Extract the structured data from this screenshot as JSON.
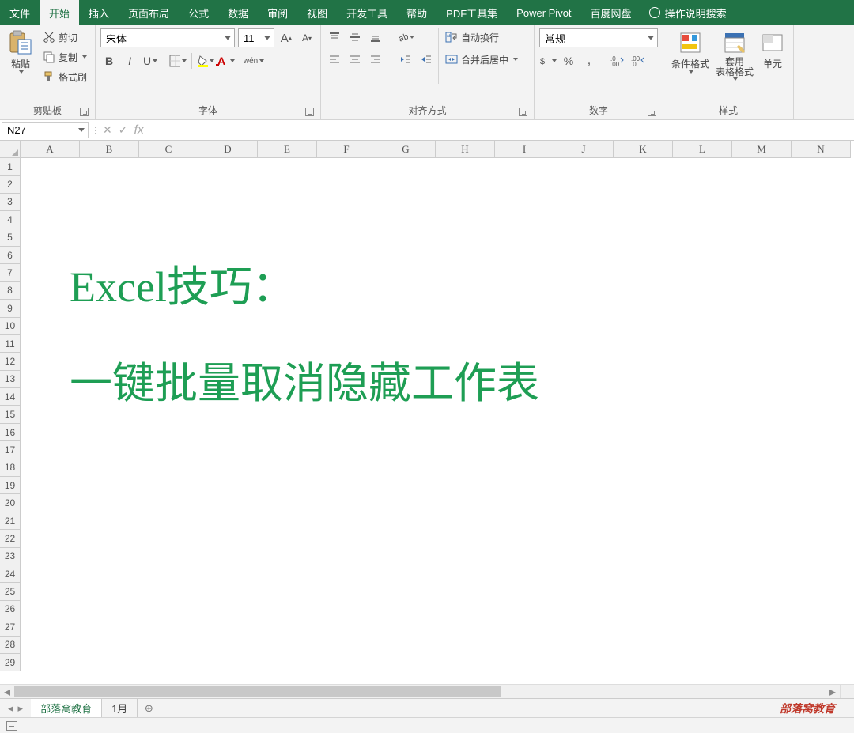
{
  "tabs": {
    "file": "文件",
    "home": "开始",
    "insert": "插入",
    "layout": "页面布局",
    "formulas": "公式",
    "data": "数据",
    "review": "审阅",
    "view": "视图",
    "dev": "开发工具",
    "help": "帮助",
    "pdf": "PDF工具集",
    "pivot": "Power Pivot",
    "baidu": "百度网盘",
    "tell": "操作说明搜索"
  },
  "ribbon": {
    "clipboard": {
      "label": "剪贴板",
      "paste": "粘贴",
      "cut": "剪切",
      "copy": "复制",
      "painter": "格式刷"
    },
    "font": {
      "label": "字体",
      "name": "宋体",
      "size": "11",
      "bold": "B",
      "italic": "I",
      "underline": "U",
      "phonetic": "wén"
    },
    "align": {
      "label": "对齐方式",
      "wrap": "自动换行",
      "merge": "合并后居中"
    },
    "number": {
      "label": "数字",
      "format": "常规"
    },
    "styles": {
      "label": "样式",
      "cond": "条件格式",
      "table": "套用\n表格格式",
      "cell": "单元"
    }
  },
  "namebox": "N27",
  "fx_label": "fx",
  "columns": [
    "A",
    "B",
    "C",
    "D",
    "E",
    "F",
    "G",
    "H",
    "I",
    "J",
    "K",
    "L",
    "M",
    "N"
  ],
  "rows_count": 29,
  "content": {
    "line1": "Excel技巧：",
    "line2": "一键批量取消隐藏工作表"
  },
  "sheets": {
    "active": "部落窝教育",
    "other": "1月",
    "add": "⊕"
  },
  "watermark": "部落窝教育"
}
